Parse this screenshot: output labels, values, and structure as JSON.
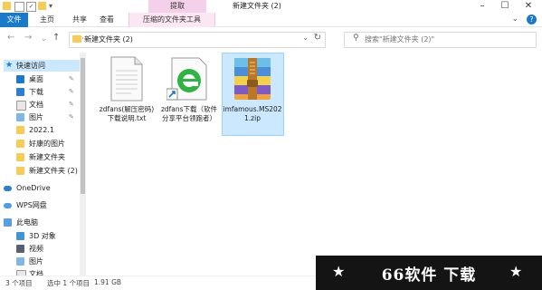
{
  "window": {
    "title": "新建文件夹 (2)",
    "extract_context_tab": "提取"
  },
  "ribbon": {
    "tabs": [
      "文件",
      "主页",
      "共享",
      "查看"
    ],
    "context_tab": "压缩的文件夹工具"
  },
  "address": {
    "path": "新建文件夹 (2)",
    "search_placeholder": "搜索\"新建文件夹 (2)\""
  },
  "nav": {
    "quick_access": "快速访问",
    "items": [
      {
        "label": "桌面",
        "pinned": true,
        "icon": "desktop-icon"
      },
      {
        "label": "下载",
        "pinned": true,
        "icon": "download-icon"
      },
      {
        "label": "文档",
        "pinned": true,
        "icon": "document-icon"
      },
      {
        "label": "图片",
        "pinned": true,
        "icon": "picture-icon"
      },
      {
        "label": "2022.1",
        "pinned": false,
        "icon": "folder-icon"
      },
      {
        "label": "好康的图片",
        "pinned": false,
        "icon": "folder-icon"
      },
      {
        "label": "新建文件夹",
        "pinned": false,
        "icon": "folder-icon"
      },
      {
        "label": "新建文件夹 (2)",
        "pinned": false,
        "icon": "folder-icon"
      }
    ],
    "onedrive": "OneDrive",
    "wps": "WPS网盘",
    "this_pc": "此电脑",
    "pc_items": [
      "3D 对象",
      "视频",
      "图片",
      "文档"
    ]
  },
  "files": [
    {
      "name": "zdfans(解压密码)下载说明.txt",
      "type": "txt-file-icon"
    },
    {
      "name": "zdfans下载（软件分享平台领跑者）",
      "type": "ie-shortcut-icon"
    },
    {
      "name": "imfamous.MS2021.zip",
      "type": "winrar-archive-icon",
      "selected": true
    }
  ],
  "status": {
    "count": "3 个项目",
    "selected": "选中 1 个项目",
    "size": "1.91 GB"
  },
  "watermark": {
    "text": "66软件 下载",
    "star": "★"
  },
  "colors": {
    "accent": "#1979ca",
    "selection": "#cce8ff",
    "context_tab": "#f5d0ea",
    "folder": "#f6cc55"
  }
}
